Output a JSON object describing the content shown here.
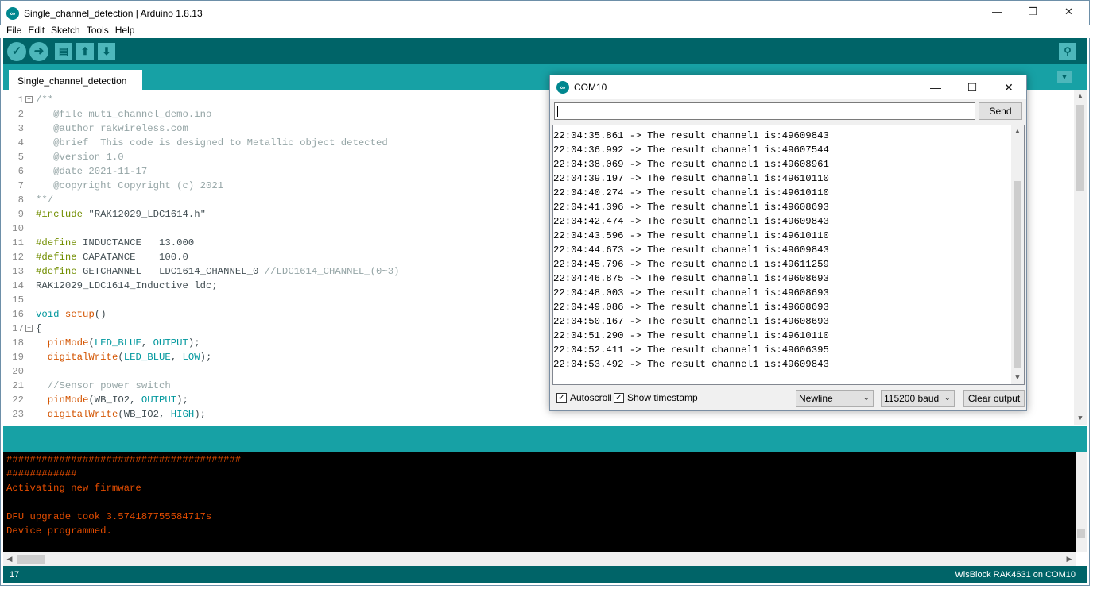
{
  "window": {
    "title": "Single_channel_detection | Arduino 1.8.13",
    "app_icon": "arduino-icon",
    "controls": {
      "minimize": "—",
      "restore": "❐",
      "close": "✕"
    }
  },
  "menu": [
    "File",
    "Edit",
    "Sketch",
    "Tools",
    "Help"
  ],
  "toolbar": {
    "verify_icon": "✓",
    "upload_icon": "➜",
    "new_icon": "▤",
    "open_icon": "⬆",
    "save_icon": "⬇",
    "serial_monitor_icon": "⚲"
  },
  "tabs": {
    "active": "Single_channel_detection",
    "menu_glyph": "▼"
  },
  "editor": {
    "lines": [
      {
        "n": "1",
        "fold": "−",
        "parts": [
          {
            "c": "c-comment",
            "t": "/**"
          }
        ]
      },
      {
        "n": "2",
        "parts": [
          {
            "c": "c-comment",
            "t": "   @file muti_channel_demo.ino"
          }
        ]
      },
      {
        "n": "3",
        "parts": [
          {
            "c": "c-comment",
            "t": "   @author rakwireless.com"
          }
        ]
      },
      {
        "n": "4",
        "parts": [
          {
            "c": "c-comment",
            "t": "   @brief  This code is designed to Metallic object detected"
          }
        ]
      },
      {
        "n": "5",
        "parts": [
          {
            "c": "c-comment",
            "t": "   @version 1.0"
          }
        ]
      },
      {
        "n": "6",
        "parts": [
          {
            "c": "c-comment",
            "t": "   @date 2021-11-17"
          }
        ]
      },
      {
        "n": "7",
        "parts": [
          {
            "c": "c-comment",
            "t": "   @copyright Copyright (c) 2021"
          }
        ]
      },
      {
        "n": "8",
        "parts": [
          {
            "c": "c-comment",
            "t": "**/"
          }
        ]
      },
      {
        "n": "9",
        "parts": [
          {
            "c": "c-pre",
            "t": "#include "
          },
          {
            "c": "c-plain",
            "t": "\"RAK12029_LDC1614.h\""
          }
        ]
      },
      {
        "n": "10",
        "parts": []
      },
      {
        "n": "11",
        "parts": [
          {
            "c": "c-pre",
            "t": "#define"
          },
          {
            "c": "c-plain",
            "t": " INDUCTANCE   13.000"
          }
        ]
      },
      {
        "n": "12",
        "parts": [
          {
            "c": "c-pre",
            "t": "#define"
          },
          {
            "c": "c-plain",
            "t": " CAPATANCE    100.0"
          }
        ]
      },
      {
        "n": "13",
        "parts": [
          {
            "c": "c-pre",
            "t": "#define"
          },
          {
            "c": "c-plain",
            "t": " GETCHANNEL   LDC1614_CHANNEL_0 "
          },
          {
            "c": "c-comment",
            "t": "//LDC1614_CHANNEL_(0~3)"
          }
        ]
      },
      {
        "n": "14",
        "parts": [
          {
            "c": "c-plain",
            "t": "RAK12029_LDC1614_Inductive ldc;"
          }
        ]
      },
      {
        "n": "15",
        "parts": []
      },
      {
        "n": "16",
        "parts": [
          {
            "c": "c-kw",
            "t": "void"
          },
          {
            "c": "c-plain",
            "t": " "
          },
          {
            "c": "c-fn",
            "t": "setup"
          },
          {
            "c": "c-plain",
            "t": "()"
          }
        ]
      },
      {
        "n": "17",
        "fold": "−",
        "parts": [
          {
            "c": "c-plain",
            "t": "{"
          }
        ]
      },
      {
        "n": "18",
        "parts": [
          {
            "c": "c-plain",
            "t": "  "
          },
          {
            "c": "c-fn",
            "t": "pinMode"
          },
          {
            "c": "c-plain",
            "t": "("
          },
          {
            "c": "c-const",
            "t": "LED_BLUE"
          },
          {
            "c": "c-plain",
            "t": ", "
          },
          {
            "c": "c-const",
            "t": "OUTPUT"
          },
          {
            "c": "c-plain",
            "t": ");"
          }
        ]
      },
      {
        "n": "19",
        "parts": [
          {
            "c": "c-plain",
            "t": "  "
          },
          {
            "c": "c-fn",
            "t": "digitalWrite"
          },
          {
            "c": "c-plain",
            "t": "("
          },
          {
            "c": "c-const",
            "t": "LED_BLUE"
          },
          {
            "c": "c-plain",
            "t": ", "
          },
          {
            "c": "c-const",
            "t": "LOW"
          },
          {
            "c": "c-plain",
            "t": ");"
          }
        ]
      },
      {
        "n": "20",
        "parts": []
      },
      {
        "n": "21",
        "parts": [
          {
            "c": "c-comment",
            "t": "  //Sensor power switch"
          }
        ]
      },
      {
        "n": "22",
        "parts": [
          {
            "c": "c-plain",
            "t": "  "
          },
          {
            "c": "c-fn",
            "t": "pinMode"
          },
          {
            "c": "c-plain",
            "t": "(WB_IO2, "
          },
          {
            "c": "c-const",
            "t": "OUTPUT"
          },
          {
            "c": "c-plain",
            "t": ");"
          }
        ]
      },
      {
        "n": "23",
        "parts": [
          {
            "c": "c-plain",
            "t": "  "
          },
          {
            "c": "c-fn",
            "t": "digitalWrite"
          },
          {
            "c": "c-plain",
            "t": "(WB_IO2, "
          },
          {
            "c": "c-const",
            "t": "HIGH"
          },
          {
            "c": "c-plain",
            "t": ");"
          }
        ]
      }
    ]
  },
  "console": {
    "lines": [
      "########################################",
      "############",
      "Activating new firmware",
      "",
      "DFU upgrade took 3.574187755584717s",
      "Device programmed."
    ]
  },
  "status": {
    "line": "17",
    "board": "WisBlock RAK4631 on COM10"
  },
  "serial_monitor": {
    "title": "COM10",
    "input_value": "",
    "send_label": "Send",
    "output": [
      "22:04:35.861 -> The result channel1 is:49609843",
      "22:04:36.992 -> The result channel1 is:49607544",
      "22:04:38.069 -> The result channel1 is:49608961",
      "22:04:39.197 -> The result channel1 is:49610110",
      "22:04:40.274 -> The result channel1 is:49610110",
      "22:04:41.396 -> The result channel1 is:49608693",
      "22:04:42.474 -> The result channel1 is:49609843",
      "22:04:43.596 -> The result channel1 is:49610110",
      "22:04:44.673 -> The result channel1 is:49609843",
      "22:04:45.796 -> The result channel1 is:49611259",
      "22:04:46.875 -> The result channel1 is:49608693",
      "22:04:48.003 -> The result channel1 is:49608693",
      "22:04:49.086 -> The result channel1 is:49608693",
      "22:04:50.167 -> The result channel1 is:49608693",
      "22:04:51.290 -> The result channel1 is:49610110",
      "22:04:52.411 -> The result channel1 is:49606395",
      "22:04:53.492 -> The result channel1 is:49609843"
    ],
    "autoscroll": {
      "label": "Autoscroll",
      "checked": true
    },
    "timestamp": {
      "label": "Show timestamp",
      "checked": true
    },
    "line_ending": "Newline",
    "baud": "115200 baud",
    "clear_label": "Clear output",
    "check_glyph": "✓",
    "dropdown_glyph": "⌄"
  },
  "colors": {
    "toolbar": "#006468",
    "tabbar": "#17a1a5",
    "console_text": "#e34c00",
    "console_bg": "#000000"
  }
}
